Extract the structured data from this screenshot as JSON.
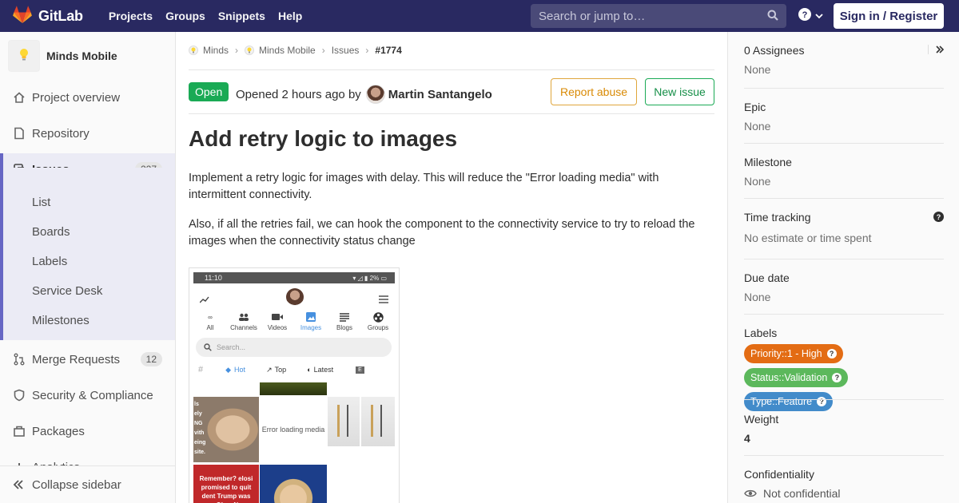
{
  "navbar": {
    "brand": "GitLab",
    "links": [
      "Projects",
      "Groups",
      "Snippets",
      "Help"
    ],
    "search_placeholder": "Search or jump to…",
    "signin": "Sign in / Register"
  },
  "sidebar": {
    "project_name": "Minds Mobile",
    "items": {
      "overview": "Project overview",
      "repository": "Repository",
      "issues": "Issues",
      "issues_count": "227",
      "merge_requests": "Merge Requests",
      "merge_requests_count": "12",
      "security": "Security & Compliance",
      "packages": "Packages",
      "analytics": "Analytics"
    },
    "issue_subitems": [
      "List",
      "Boards",
      "Labels",
      "Service Desk",
      "Milestones"
    ],
    "collapse": "Collapse sidebar"
  },
  "breadcrumb": {
    "group": "Minds",
    "project": "Minds Mobile",
    "section": "Issues",
    "current": "#1774"
  },
  "issue": {
    "status": "Open",
    "opened_prefix": "Opened 2 hours ago by",
    "author": "Martin Santangelo",
    "report_abuse": "Report abuse",
    "new_issue": "New issue",
    "title": "Add retry logic to images",
    "paragraph1": "Implement a retry logic for images with delay. This will reduce the \"Error loading media\" with intermittent connectivity.",
    "paragraph2": "Also, if all the retries fail, we can hook the component to the connectivity service to try to reload the images when the connectivity status change"
  },
  "screenshot": {
    "time": "11:10",
    "battery": "2%",
    "tabs": [
      "All",
      "Channels",
      "Videos",
      "Images",
      "Blogs",
      "Groups"
    ],
    "selected_tab": "Images",
    "search_placeholder": "Search...",
    "filters": [
      "Hot",
      "Top",
      "Latest"
    ],
    "error_text": "Error loading media",
    "meme_text": "Remember? elosi promised to quit dent Trump was acqu Okay Nancy"
  },
  "right_sidebar": {
    "assignees_title": "0 Assignees",
    "assignees_value": "None",
    "epic_title": "Epic",
    "epic_value": "None",
    "milestone_title": "Milestone",
    "milestone_value": "None",
    "time_tracking_title": "Time tracking",
    "time_tracking_value": "No estimate or time spent",
    "due_date_title": "Due date",
    "due_date_value": "None",
    "labels_title": "Labels",
    "labels": [
      {
        "text": "Priority::1 - High",
        "color": "#e36c14"
      },
      {
        "text": "Status::Validation",
        "color": "#5cb85c"
      },
      {
        "text": "Type::Feature",
        "color": "#428bca"
      }
    ],
    "weight_title": "Weight",
    "weight_value": "4",
    "confidentiality_title": "Confidentiality",
    "confidentiality_value": "Not confidential"
  },
  "colors": {
    "navbar": "#292961",
    "accent": "#6666c4",
    "open_badge": "#1aaa55"
  }
}
